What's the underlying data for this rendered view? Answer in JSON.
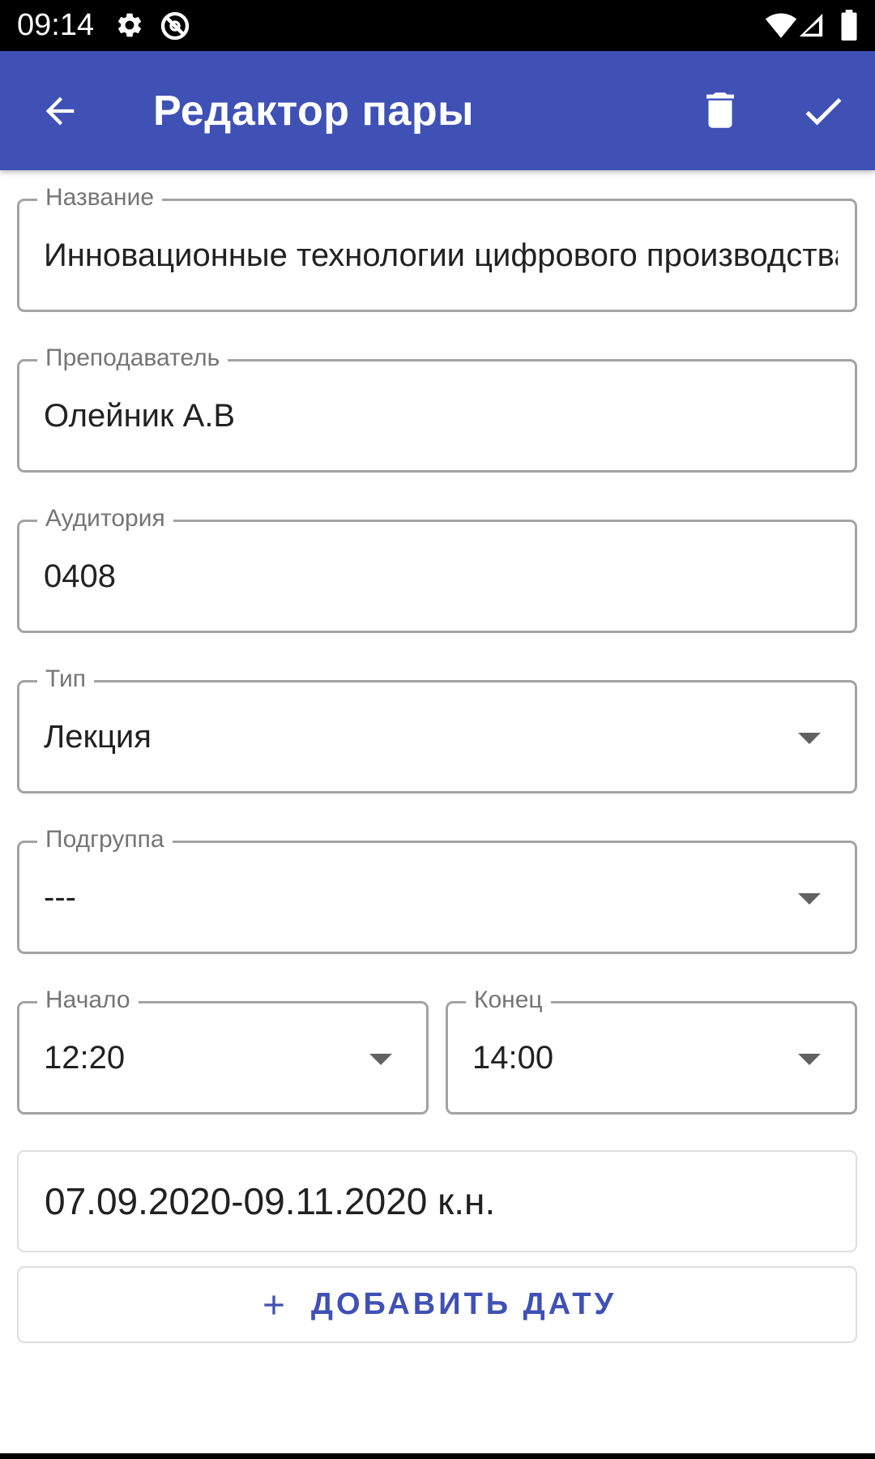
{
  "status_bar": {
    "time": "09:14",
    "icons": [
      "gear-icon",
      "do-not-disturb-icon",
      "wifi-icon",
      "signal-icon",
      "battery-icon"
    ]
  },
  "app_bar": {
    "title": "Редактор пары",
    "back_icon": "arrow-left-icon",
    "delete_icon": "trash-icon",
    "confirm_icon": "check-icon"
  },
  "form": {
    "name": {
      "label": "Название",
      "value": "Инновационные технологии цифрового производства"
    },
    "teacher": {
      "label": "Преподаватель",
      "value": "Олейник А.В"
    },
    "room": {
      "label": "Аудитория",
      "value": "0408"
    },
    "type": {
      "label": "Тип",
      "value": "Лекция"
    },
    "subgroup": {
      "label": "Подгруппа",
      "value": "---"
    },
    "start": {
      "label": "Начало",
      "value": "12:20"
    },
    "end": {
      "label": "Конец",
      "value": "14:00"
    }
  },
  "dates": {
    "items": [
      {
        "text": "07.09.2020-09.11.2020 к.н."
      }
    ],
    "add_label": "ДОБАВИТЬ ДАТУ"
  },
  "colors": {
    "primary": "#3f51b5",
    "status_bar": "#000000",
    "outline": "#a3a3a3",
    "label": "#757575"
  }
}
